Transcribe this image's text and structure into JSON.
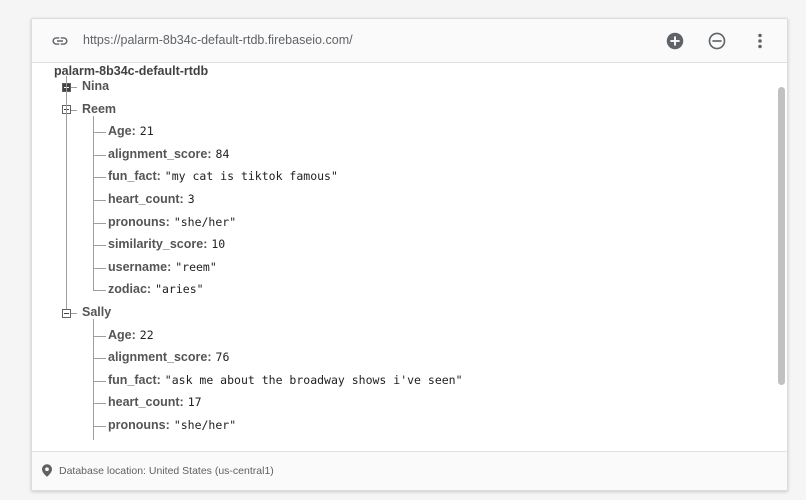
{
  "url": "https://palarm-8b34c-default-rtdb.firebaseio.com/",
  "toolbar": {
    "add_icon": "add-circle-icon",
    "remove_icon": "remove-circle-icon",
    "more_icon": "more-vert-icon"
  },
  "tree": {
    "root": "palarm-8b34c-default-rtdb",
    "nodes": [
      {
        "name": "Nina",
        "state": "collapsed",
        "children": []
      },
      {
        "name": "Reem",
        "state": "expanded",
        "children": [
          {
            "key": "Age",
            "value": "21"
          },
          {
            "key": "alignment_score",
            "value": "84"
          },
          {
            "key": "fun_fact",
            "value": "\"my cat is tiktok famous\""
          },
          {
            "key": "heart_count",
            "value": "3"
          },
          {
            "key": "pronouns",
            "value": "\"she/her\""
          },
          {
            "key": "similarity_score",
            "value": "10"
          },
          {
            "key": "username",
            "value": "\"reem\""
          },
          {
            "key": "zodiac",
            "value": "\"aries\""
          }
        ]
      },
      {
        "name": "Sally",
        "state": "expanded",
        "children": [
          {
            "key": "Age",
            "value": "22"
          },
          {
            "key": "alignment_score",
            "value": "76"
          },
          {
            "key": "fun_fact",
            "value": "\"ask me about the broadway shows i've seen\""
          },
          {
            "key": "heart_count",
            "value": "17"
          },
          {
            "key": "pronouns",
            "value": "\"she/her\""
          }
        ]
      }
    ]
  },
  "footer": {
    "text": "Database location: United States (us-central1)"
  },
  "colors": {
    "toolbar_icon": "#5f6368",
    "tree_line": "#9e9e9e",
    "scrollbar": "#c1c1c1"
  }
}
